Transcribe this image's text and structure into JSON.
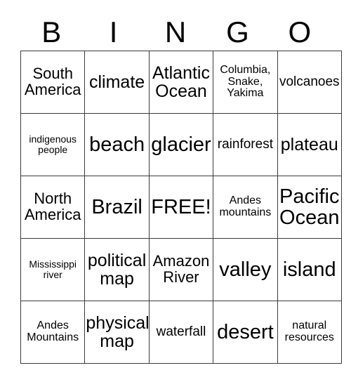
{
  "header": {
    "letters": [
      "B",
      "I",
      "N",
      "G",
      "O"
    ]
  },
  "grid": {
    "rows": [
      [
        {
          "text": "South\nAmerica",
          "size": "fs-l"
        },
        {
          "text": "climate",
          "size": "fs-xl"
        },
        {
          "text": "Atlantic\nOcean",
          "size": "fs-xl"
        },
        {
          "text": "Columbia,\nSnake,\nYakima",
          "size": "fs-s"
        },
        {
          "text": "volcanoes",
          "size": "fs-m"
        }
      ],
      [
        {
          "text": "indigenous\npeople",
          "size": "fs-xs"
        },
        {
          "text": "beach",
          "size": "fs-xxl"
        },
        {
          "text": "glacier",
          "size": "fs-xxl"
        },
        {
          "text": "rainforest",
          "size": "fs-m"
        },
        {
          "text": "plateau",
          "size": "fs-xl"
        }
      ],
      [
        {
          "text": "North\nAmerica",
          "size": "fs-l"
        },
        {
          "text": "Brazil",
          "size": "fs-xxl"
        },
        {
          "text": "FREE!",
          "size": "fs-xxl"
        },
        {
          "text": "Andes\nmountains",
          "size": "fs-s"
        },
        {
          "text": "Pacific\nOcean",
          "size": "fs-xxl"
        }
      ],
      [
        {
          "text": "Mississippi\nriver",
          "size": "fs-xs"
        },
        {
          "text": "political\nmap",
          "size": "fs-xl"
        },
        {
          "text": "Amazon\nRiver",
          "size": "fs-l"
        },
        {
          "text": "valley",
          "size": "fs-xxl"
        },
        {
          "text": "island",
          "size": "fs-xxl"
        }
      ],
      [
        {
          "text": "Andes\nMountains",
          "size": "fs-s"
        },
        {
          "text": "physical\nmap",
          "size": "fs-xl"
        },
        {
          "text": "waterfall",
          "size": "fs-m"
        },
        {
          "text": "desert",
          "size": "fs-xxl"
        },
        {
          "text": "natural\nresources",
          "size": "fs-s"
        }
      ]
    ]
  },
  "colors": {
    "background": "#ffffff",
    "text": "#000000",
    "grid_line": "#3a3a3a"
  }
}
